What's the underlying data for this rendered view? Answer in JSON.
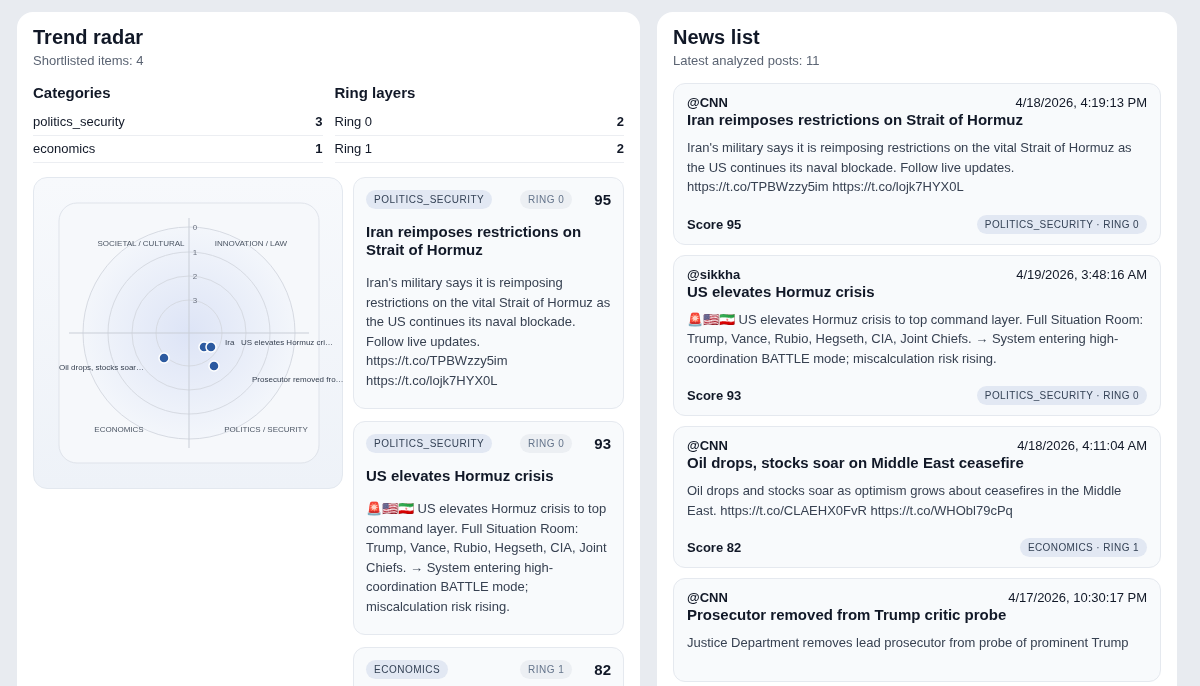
{
  "trend_radar": {
    "title": "Trend radar",
    "subtitle": "Shortlisted items: 4",
    "categories": {
      "title": "Categories",
      "rows": [
        {
          "label": "politics_security",
          "count": "3"
        },
        {
          "label": "economics",
          "count": "1"
        }
      ]
    },
    "ring_layers": {
      "title": "Ring layers",
      "rows": [
        {
          "label": "Ring 0",
          "count": "2"
        },
        {
          "label": "Ring 1",
          "count": "2"
        }
      ]
    },
    "radar": {
      "ring_ticks": [
        "0",
        "1",
        "2",
        "3"
      ],
      "quadrants": [
        "SOCIETAL / CULTURAL",
        "INNOVATION / LAW",
        "ECONOMICS",
        "POLITICS / SECURITY"
      ],
      "points": [
        {
          "label": "Oil drops, stocks soar…"
        },
        {
          "label": "Ira"
        },
        {
          "label": "US elevates Hormuz cri…"
        },
        {
          "label": "Prosecutor removed fro…"
        }
      ]
    },
    "cards": [
      {
        "category": "POLITICS_SECURITY",
        "ring": "RING 0",
        "score": "95",
        "title": "Iran reimposes restrictions on Strait of Hormuz",
        "body": "Iran's military says it is reimposing restrictions on the vital Strait of Hormuz as the US continues its naval blockade. Follow live updates. https://t.co/TPBWzzy5im https://t.co/lojk7HYX0L"
      },
      {
        "category": "POLITICS_SECURITY",
        "ring": "RING 0",
        "score": "93",
        "title": "US elevates Hormuz crisis",
        "body": "🚨🇺🇸🇮🇷 US elevates Hormuz crisis to top command layer. Full Situation Room: Trump, Vance, Rubio, Hegseth, CIA, Joint Chiefs. → System entering high-coordination BATTLE mode; miscalculation risk rising."
      },
      {
        "category": "ECONOMICS",
        "ring": "RING 1",
        "score": "82"
      }
    ]
  },
  "news_list": {
    "title": "News list",
    "subtitle": "Latest analyzed posts: 11",
    "posts": [
      {
        "author": "@CNN",
        "time": "4/18/2026, 4:19:13 PM",
        "title": "Iran reimposes restrictions on Strait of Hormuz",
        "body": "Iran's military says it is reimposing restrictions on the vital Strait of Hormuz as the US continues its naval blockade. Follow live updates. https://t.co/TPBWzzy5im https://t.co/lojk7HYX0L",
        "score": "Score 95",
        "tag": "POLITICS_SECURITY · RING 0"
      },
      {
        "author": "@sikkha",
        "time": "4/19/2026, 3:48:16 AM",
        "title": "US elevates Hormuz crisis",
        "body": "🚨🇺🇸🇮🇷 US elevates Hormuz crisis to top command layer. Full Situation Room: Trump, Vance, Rubio, Hegseth, CIA, Joint Chiefs. → System entering high-coordination BATTLE mode; miscalculation risk rising.",
        "score": "Score 93",
        "tag": "POLITICS_SECURITY · RING 0"
      },
      {
        "author": "@CNN",
        "time": "4/18/2026, 4:11:04 AM",
        "title": "Oil drops, stocks soar on Middle East ceasefire",
        "body": "Oil drops and stocks soar as optimism grows about ceasefires in the Middle East. https://t.co/CLAEHX0FvR https://t.co/WHObl79cPq",
        "score": "Score 82",
        "tag": "ECONOMICS · RING 1"
      },
      {
        "author": "@CNN",
        "time": "4/17/2026, 10:30:17 PM",
        "title": "Prosecutor removed from Trump critic probe",
        "body": "Justice Department removes lead prosecutor from probe of prominent Trump"
      }
    ]
  }
}
